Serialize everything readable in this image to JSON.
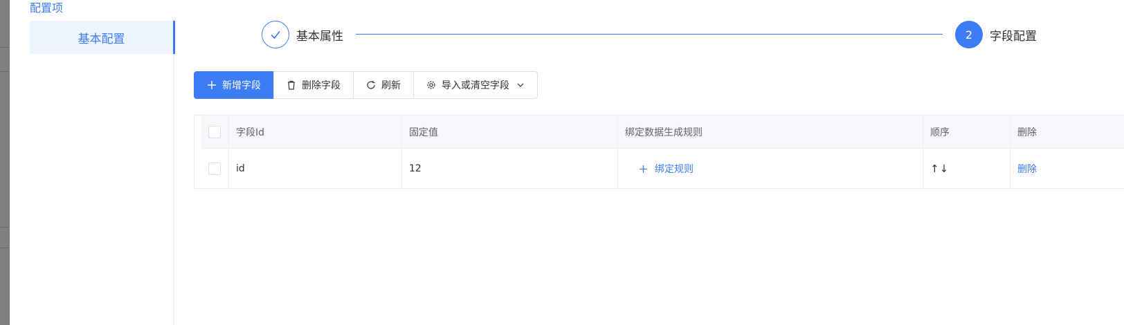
{
  "config_title": "配置项",
  "nav": {
    "items": [
      {
        "label": "基本配置",
        "active": true
      }
    ]
  },
  "steps": [
    {
      "label": "基本属性",
      "status": "done",
      "icon": "check-icon"
    },
    {
      "label": "字段配置",
      "status": "active",
      "number": "2"
    }
  ],
  "toolbar": {
    "add_label": "新增字段",
    "delete_label": "删除字段",
    "refresh_label": "刷新",
    "import_label": "导入或清空字段"
  },
  "table": {
    "headers": {
      "field_id": "字段Id",
      "fixed_value": "固定值",
      "bind_rule": "绑定数据生成规则",
      "order": "顺序",
      "delete": "删除"
    },
    "rows": [
      {
        "field_id": "id",
        "fixed_value": "12",
        "bind_rule_action": "绑定规则",
        "order_arrows": "↑↓",
        "delete_action": "删除"
      }
    ]
  },
  "colors": {
    "accent": "#3b7cf5",
    "header_bg": "#f5f7fa",
    "nav_active_bg": "#eef5ff"
  }
}
